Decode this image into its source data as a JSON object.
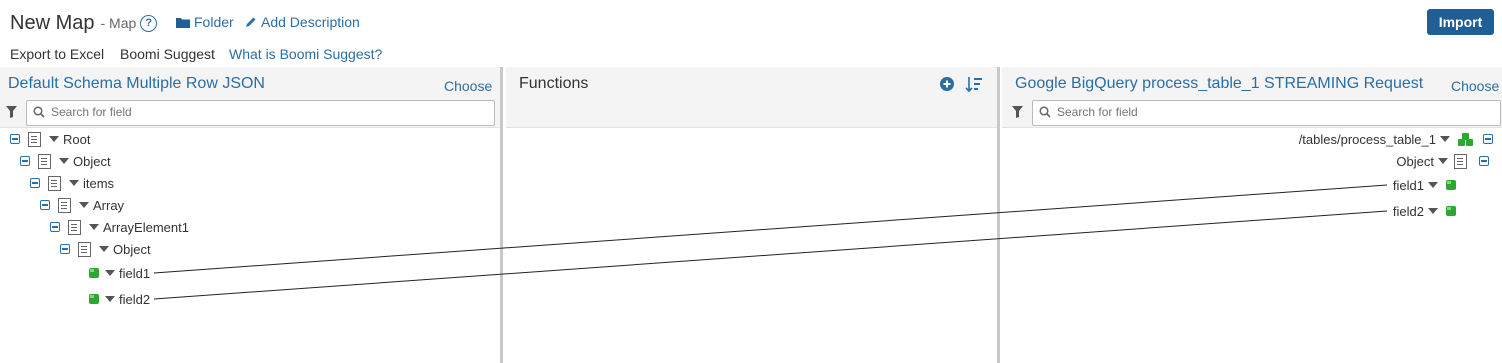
{
  "header": {
    "title": "New Map",
    "subtitle": "- Map",
    "help": "?",
    "folder_label": "Folder",
    "add_description_label": "Add Description",
    "import_label": "Import"
  },
  "menu": {
    "export": "Export to Excel",
    "suggest": "Boomi Suggest",
    "what_is": "What is Boomi Suggest?"
  },
  "source": {
    "title": "Default Schema Multiple Row JSON",
    "choose": "Choose",
    "search_placeholder": "Search for field",
    "nodes": [
      "Root",
      "Object",
      "items",
      "Array",
      "ArrayElement1",
      "Object",
      "field1",
      "field2"
    ]
  },
  "functions": {
    "title": "Functions"
  },
  "destination": {
    "title": "Google BigQuery process_table_1 STREAMING Request",
    "choose": "Choose",
    "search_placeholder": "Search for field",
    "nodes": [
      "/tables/process_table_1",
      "Object",
      "field1",
      "field2"
    ]
  },
  "colors": {
    "accent": "#2a6ea6",
    "button": "#1f5f96",
    "field_icon": "#2fa534"
  },
  "mappings": [
    {
      "from": "field1",
      "to": "field1"
    },
    {
      "from": "field2",
      "to": "field2"
    }
  ]
}
